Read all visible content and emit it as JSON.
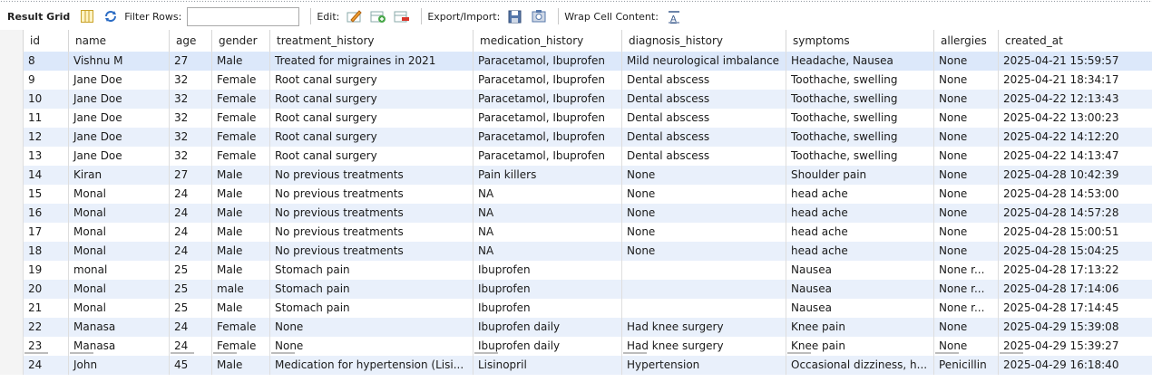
{
  "toolbar": {
    "title": "Result Grid",
    "filter_label": "Filter Rows:",
    "filter_value": "",
    "edit_label": "Edit:",
    "export_label": "Export/Import:",
    "wrap_label": "Wrap Cell Content:"
  },
  "columns": [
    "id",
    "name",
    "age",
    "gender",
    "treatment_history",
    "medication_history",
    "diagnosis_history",
    "symptoms",
    "allergies",
    "created_at"
  ],
  "rows": [
    [
      "8",
      "Vishnu M",
      "27",
      "Male",
      "Treated for migraines in 2021",
      "Paracetamol, Ibuprofen",
      "Mild neurological imbalance",
      "Headache, Nausea",
      "None",
      "2025-04-21 15:59:57"
    ],
    [
      "9",
      "Jane Doe",
      "32",
      "Female",
      "Root canal surgery",
      "Paracetamol, Ibuprofen",
      "Dental abscess",
      "Toothache, swelling",
      "None",
      "2025-04-21 18:34:17"
    ],
    [
      "10",
      "Jane Doe",
      "32",
      "Female",
      "Root canal surgery",
      "Paracetamol, Ibuprofen",
      "Dental abscess",
      "Toothache, swelling",
      "None",
      "2025-04-22 12:13:43"
    ],
    [
      "11",
      "Jane Doe",
      "32",
      "Female",
      "Root canal surgery",
      "Paracetamol, Ibuprofen",
      "Dental abscess",
      "Toothache, swelling",
      "None",
      "2025-04-22 13:00:23"
    ],
    [
      "12",
      "Jane Doe",
      "32",
      "Female",
      "Root canal surgery",
      "Paracetamol, Ibuprofen",
      "Dental abscess",
      "Toothache, swelling",
      "None",
      "2025-04-22 14:12:20"
    ],
    [
      "13",
      "Jane Doe",
      "32",
      "Female",
      "Root canal surgery",
      "Paracetamol, Ibuprofen",
      "Dental abscess",
      "Toothache, swelling",
      "None",
      "2025-04-22 14:13:47"
    ],
    [
      "14",
      "Kiran",
      "27",
      "Male",
      "No previous treatments",
      "Pain killers",
      "None",
      "Shoulder pain",
      "None",
      "2025-04-28 10:42:39"
    ],
    [
      "15",
      "Monal",
      "24",
      "Male",
      "No previous treatments",
      "NA",
      "None",
      "head ache",
      "None",
      "2025-04-28 14:53:00"
    ],
    [
      "16",
      "Monal",
      "24",
      "Male",
      "No previous treatments",
      "NA",
      "None",
      "head ache",
      "None",
      "2025-04-28 14:57:28"
    ],
    [
      "17",
      "Monal",
      "24",
      "Male",
      "No previous treatments",
      "NA",
      "None",
      "head ache",
      "None",
      "2025-04-28 15:00:51"
    ],
    [
      "18",
      "Monal",
      "24",
      "Male",
      "No previous treatments",
      "NA",
      "None",
      "head ache",
      "None",
      "2025-04-28 15:04:25"
    ],
    [
      "19",
      "monal",
      "25",
      "Male",
      "Stomach pain",
      "Ibuprofen",
      "",
      "Nausea",
      "None r...",
      "2025-04-28 17:13:22"
    ],
    [
      "20",
      "Monal",
      "25",
      "male",
      "Stomach pain",
      "Ibuprofen",
      "",
      "Nausea",
      "None r...",
      "2025-04-28 17:14:06"
    ],
    [
      "21",
      "Monal",
      "25",
      "Male",
      "Stomach pain",
      "Ibuprofen",
      "",
      "Nausea",
      "None r...",
      "2025-04-28 17:14:45"
    ],
    [
      "22",
      "Manasa",
      "24",
      "Female",
      "None",
      "Ibuprofen daily",
      "Had knee surgery",
      "Knee pain",
      "None",
      "2025-04-29 15:39:08"
    ],
    [
      "23",
      "Manasa",
      "24",
      "Female",
      "None",
      "Ibuprofen daily",
      "Had knee surgery",
      "Knee pain",
      "None",
      "2025-04-29 15:39:27"
    ],
    [
      "24",
      "John",
      "45",
      "Male",
      "Medication for hypertension (Lisi...",
      "Lisinopril",
      "Hypertension",
      "Occasional dizziness, h...",
      "Penicillin",
      "2025-04-29 16:18:40"
    ]
  ]
}
